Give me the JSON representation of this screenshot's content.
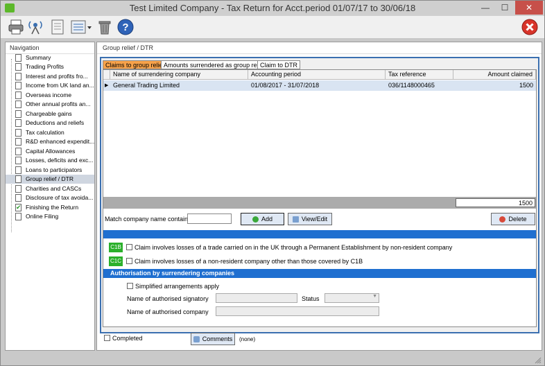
{
  "window": {
    "title": "Test Limited Company - Tax Return for Acct.period 01/07/17 to 30/06/18",
    "minimize": "—",
    "maximize": "☐",
    "close": "✕"
  },
  "colors": {
    "accent": "#1f6fd0",
    "active_tab": "#f7a24a",
    "code_badge": "#2bb02b",
    "close_red": "#c7504a"
  },
  "toolbar": {
    "icons": [
      "printer-icon",
      "broadcast-icon",
      "document-icon",
      "list-dropdown-icon",
      "trash-icon",
      "help-icon",
      "exit-icon"
    ]
  },
  "navigation": {
    "header": "Navigation",
    "items": [
      {
        "label": "Summary"
      },
      {
        "label": "Trading Profits"
      },
      {
        "label": "Interest and profits fro..."
      },
      {
        "label": "Income from UK land an..."
      },
      {
        "label": "Overseas income"
      },
      {
        "label": "Other annual profits an..."
      },
      {
        "label": "Chargeable gains"
      },
      {
        "label": "Deductions and reliefs"
      },
      {
        "label": "Tax calculation"
      },
      {
        "label": "R&D enhanced expendit..."
      },
      {
        "label": "Capital Allowances"
      },
      {
        "label": "Losses, deficits and exc..."
      },
      {
        "label": "Loans to participators"
      },
      {
        "label": "Group relief / DTR"
      },
      {
        "label": "Charities and CASCs"
      },
      {
        "label": "Disclosure of tax avoida..."
      },
      {
        "label": "Finishing the Return"
      },
      {
        "label": "Online Filing"
      }
    ]
  },
  "main": {
    "header": "Group relief / DTR",
    "tabs": [
      {
        "label": "Claims to group relief"
      },
      {
        "label": "Amounts surrendered as group relief"
      },
      {
        "label": "Claim to DTR"
      }
    ],
    "grid": {
      "columns": [
        "Name of surrendering company",
        "Accounting period",
        "Tax reference",
        "Amount claimed"
      ],
      "rows": [
        {
          "company": "General Trading Limited",
          "period": "01/08/2017 - 31/07/2018",
          "taxref": "036/1148000465",
          "amount": "1500"
        }
      ],
      "row_marker": "▶",
      "total": "1500"
    },
    "match_label": "Match company name contains",
    "match_value": "",
    "add_label": "Add",
    "view_edit_label": "View/Edit",
    "delete_label": "Delete",
    "c1b": {
      "code": "C1B",
      "label": "Claim involves losses of a trade carried on in the UK through a Permanent Establishment by non-resident company"
    },
    "c1c": {
      "code": "C1C",
      "label": "Claim involves losses of a non-resident company other than those covered by C1B"
    },
    "auth": {
      "header": "Authorisation by surrendering companies",
      "simplified_label": "Simplified arrangements apply",
      "signatory_label": "Name of authorised signatory",
      "status_label": "Status",
      "company_label": "Name of authorised company"
    },
    "completed_label": "Completed",
    "comments_label": "Comments",
    "comments_status": "(none)"
  }
}
